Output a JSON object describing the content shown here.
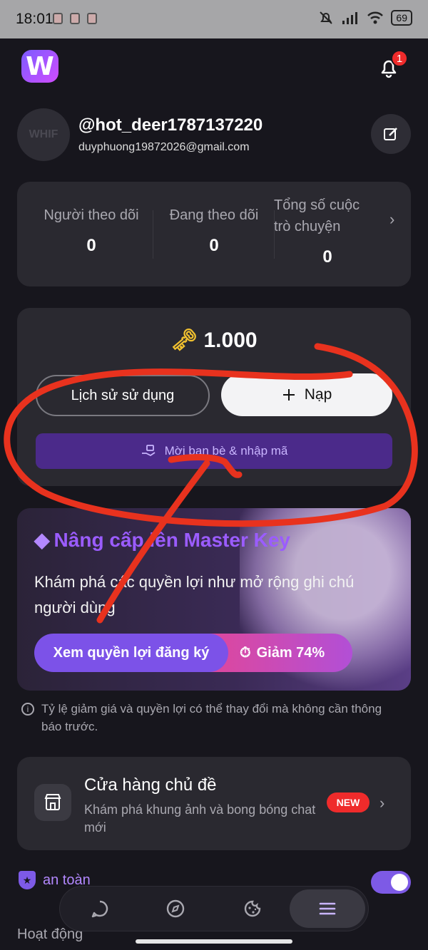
{
  "status_bar": {
    "time": "18:01",
    "battery": "69"
  },
  "app": {
    "logo_letter": "W",
    "notification_count": "1"
  },
  "profile": {
    "avatar_text": "WHIF",
    "username": "@hot_deer1787137220",
    "email": "duyphuong19872026@gmail.com"
  },
  "stats": {
    "followers_label": "Người theo dõi",
    "followers_value": "0",
    "following_label": "Đang theo dõi",
    "following_value": "0",
    "chats_label_line1": "Tổng số cuộc",
    "chats_label_line2": "trò chuyện",
    "chats_value": "0"
  },
  "wallet": {
    "balance": "1.000",
    "history_label": "Lịch sử sử dụng",
    "topup_label": "Nạp",
    "invite_label": "Mời bạn bè & nhập mã"
  },
  "premium": {
    "title": "Nâng cấp lên Master Key",
    "description": "Khám phá các quyền lợi như mở rộng ghi chú người dùng",
    "benefits_label": "Xem quyền lợi đăng ký",
    "discount_label": "Giảm 74%"
  },
  "notice": "Tỷ lệ giảm giá và quyền lợi có thể thay đổi mà không cần thông báo trước.",
  "theme_shop": {
    "title": "Cửa hàng chủ đề",
    "subtitle": "Khám phá khung ảnh và bong bóng chat mới",
    "badge": "NEW"
  },
  "safety": {
    "label": "an toàn",
    "enabled": true
  },
  "activity_label": "Hoạt động",
  "bottom_nav": {
    "items": [
      "chat-icon",
      "explore-icon",
      "cookie-icon",
      "menu-icon"
    ],
    "active": "menu-icon"
  },
  "colors": {
    "background": "#17161d",
    "card": "#2a2930",
    "accent": "#7c52e8",
    "badge_red": "#ef2b2b",
    "annotation": "#e8321e"
  }
}
